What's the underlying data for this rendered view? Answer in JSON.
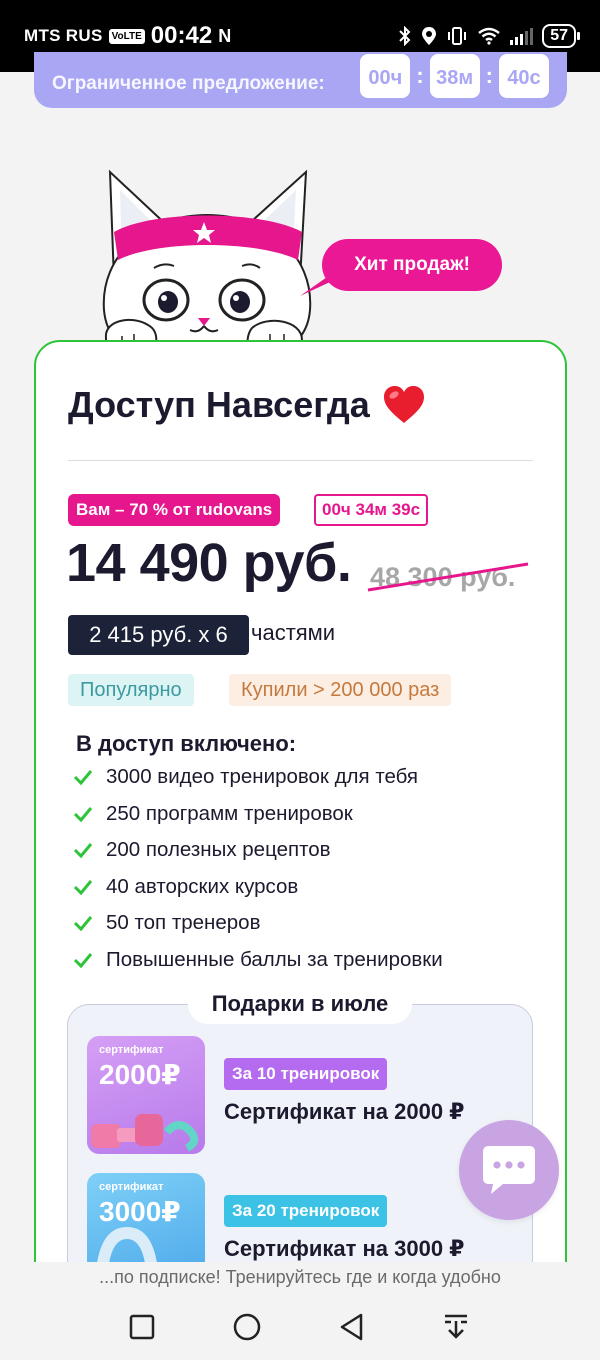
{
  "status_bar": {
    "carrier": "MTS RUS",
    "volte": "VoLTE",
    "time": "00:42",
    "nfc": "N",
    "battery": "57"
  },
  "offer": {
    "text": "Ограниченное предложение:",
    "hours": "00ч",
    "minutes": "38м",
    "seconds": "40с"
  },
  "hero": {
    "bubble_text": "Хит продаж!"
  },
  "plan": {
    "title": "Доступ Навсегда",
    "title_emoji": "❤️",
    "discount_badge": "Вам – 70 % от rudovans",
    "timer_badge": "00ч 34м 39с",
    "price": "14 490 руб.",
    "old_price": "48 300 руб.",
    "installment": "2 415 руб. x 6",
    "installment_suffix": "частями",
    "tag_popular": "Популярно",
    "tag_bought": "Купили > 200 000 раз",
    "included_title": "В доступ включено:",
    "features": [
      "3000 видео тренировок для тебя",
      "250 программ тренировок",
      "200 полезных рецептов",
      "40 авторских курсов",
      "50 топ тренеров",
      "Повышенные баллы за тренировки"
    ]
  },
  "gifts": {
    "title": "Подарки в июле",
    "items": [
      {
        "cert_label": "сертификат",
        "cert_amount": "2000₽",
        "badge": "За 10 тренировок",
        "name": "Сертификат на 2000 ₽"
      },
      {
        "cert_label": "сертификат",
        "cert_amount": "3000₽",
        "badge": "За 20 тренировок",
        "name": "Сертификат на 3000 ₽"
      }
    ]
  },
  "footer": {
    "text": "...по подписке! Тренируйтесь где и когда удобно"
  },
  "colors": {
    "accent_pink": "#e6168d",
    "card_border": "#2ec43a",
    "offer_bg": "#a9a6f4",
    "chat_fab": "#c9a4e3"
  }
}
